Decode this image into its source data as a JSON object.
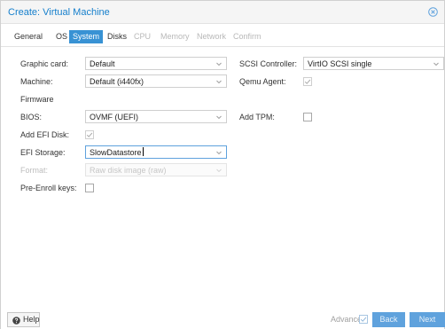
{
  "window": {
    "title": "Create: Virtual Machine"
  },
  "tabs": [
    {
      "label": "General",
      "state": "normal"
    },
    {
      "label": "OS",
      "state": "normal"
    },
    {
      "label": "System",
      "state": "active"
    },
    {
      "label": "Disks",
      "state": "normal"
    },
    {
      "label": "CPU",
      "state": "disabled"
    },
    {
      "label": "Memory",
      "state": "disabled"
    },
    {
      "label": "Network",
      "state": "disabled"
    },
    {
      "label": "Confirm",
      "state": "disabled"
    }
  ],
  "form": {
    "graphic_card": {
      "label": "Graphic card:",
      "value": "Default"
    },
    "machine": {
      "label": "Machine:",
      "value": "Default (i440fx)"
    },
    "firmware_heading": "Firmware",
    "bios": {
      "label": "BIOS:",
      "value": "OVMF (UEFI)"
    },
    "add_efi_disk": {
      "label": "Add EFI Disk:",
      "checked": true
    },
    "efi_storage": {
      "label": "EFI Storage:",
      "value": "SlowDatastore"
    },
    "format": {
      "label": "Format:",
      "value": "Raw disk image (raw)"
    },
    "pre_enroll_keys": {
      "label": "Pre-Enroll keys:",
      "checked": false
    },
    "scsi_controller": {
      "label": "SCSI Controller:",
      "value": "VirtIO SCSI single"
    },
    "qemu_agent": {
      "label": "Qemu Agent:",
      "checked": true
    },
    "add_tpm": {
      "label": "Add TPM:",
      "checked": false
    }
  },
  "footer": {
    "help_label": "Help",
    "advanced_label": "Advanced",
    "advanced_checked": true,
    "back_label": "Back",
    "next_label": "Next"
  },
  "colors": {
    "accent": "#157fcc",
    "tab_active": "#3892d4",
    "button_blue": "#5fa2dd"
  },
  "icons": {
    "close": "close-circle-icon",
    "help": "question-circle-icon",
    "dropdown": "chevron-down-icon",
    "check": "check-icon"
  }
}
